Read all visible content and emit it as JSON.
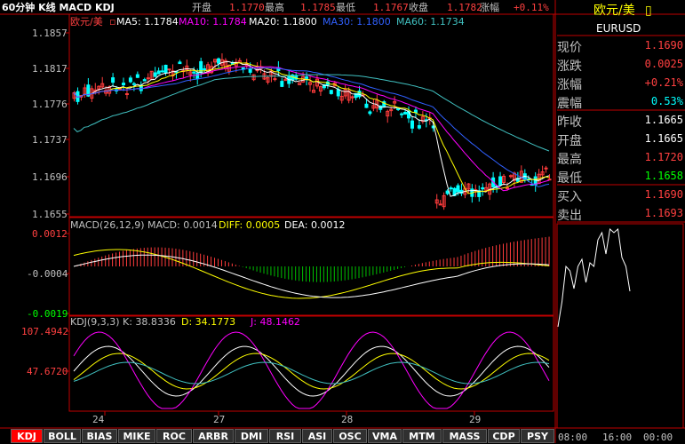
{
  "header": {
    "title": "60分钟 K线 MACD KDJ",
    "open_label": "开盘",
    "open_value": "1.1770",
    "high_label": "最高",
    "high_value": "1.1785",
    "low_label": "最低",
    "low_value": "1.1767",
    "close_label": "收盘",
    "close_value": "1.1782",
    "change_label": "涨幅",
    "change_value": "+0.11%"
  },
  "kline": {
    "symbol_label": "欧元/美",
    "ma5": "MA5: 1.1784",
    "ma10": "MA10: 1.1784",
    "ma20": "MA20: 1.1800",
    "ma30": "MA30: 1.1800",
    "ma60": "MA60: 1.1734",
    "yticks": [
      "1.1857",
      "1.1817",
      "1.1776",
      "1.1737",
      "1.1696",
      "1.1655"
    ]
  },
  "macd": {
    "label": "MACD(26,12,9) MACD: 0.0014",
    "diff": "DIFF: 0.0005",
    "dea": "DEA: 0.0012",
    "yticks": [
      "0.0012",
      "-0.0004",
      "-0.0019"
    ]
  },
  "kdj": {
    "label": "KDJ(9,3,3) K: 38.8336",
    "d": "D: 34.1773",
    "j": "J: 48.1462",
    "yticks": [
      "107.4942",
      "47.6720"
    ]
  },
  "xaxis": {
    "labels": [
      "24",
      "27",
      "28",
      "29"
    ]
  },
  "tabs": [
    "KDJ",
    "BOLL",
    "BIAS",
    "MIKE",
    "ROC",
    "ARBR",
    "DMI",
    "RSI",
    "ASI",
    "OSC",
    "VMA",
    "MTM",
    "MASS",
    "CDP",
    "PSY"
  ],
  "quote": {
    "name": "欧元/美",
    "code": "EURUSD",
    "rows": [
      {
        "label": "现价",
        "value": "1.1690",
        "color": "#ff4040"
      },
      {
        "label": "涨跌",
        "value": "0.0025",
        "color": "#ff4040"
      },
      {
        "label": "涨幅",
        "value": "+0.21%",
        "color": "#ff4040"
      },
      {
        "label": "震幅",
        "value": "0.53%",
        "color": "#00ffff"
      },
      {
        "label": "昨收",
        "value": "1.1665",
        "color": "#ffffff"
      },
      {
        "label": "开盘",
        "value": "1.1665",
        "color": "#ffffff"
      },
      {
        "label": "最高",
        "value": "1.1720",
        "color": "#ff4040"
      },
      {
        "label": "最低",
        "value": "1.1658",
        "color": "#00ff00"
      },
      {
        "label": "买入",
        "value": "1.1690",
        "color": "#ff4040"
      },
      {
        "label": "卖出",
        "value": "1.1693",
        "color": "#ff4040"
      }
    ]
  },
  "intraday": {
    "xlabels": [
      "08:00",
      "16:00",
      "00:00"
    ]
  },
  "colors": {
    "up": "#ff3c3c",
    "down": "#00ffff",
    "ma5": "#ffffff",
    "ma10": "#ffff00",
    "ma20": "#ff00ff",
    "ma30": "#3060ff",
    "ma60": "#40c0c0",
    "k": "#ffffff",
    "d": "#ffff00",
    "j": "#ff00ff"
  }
}
